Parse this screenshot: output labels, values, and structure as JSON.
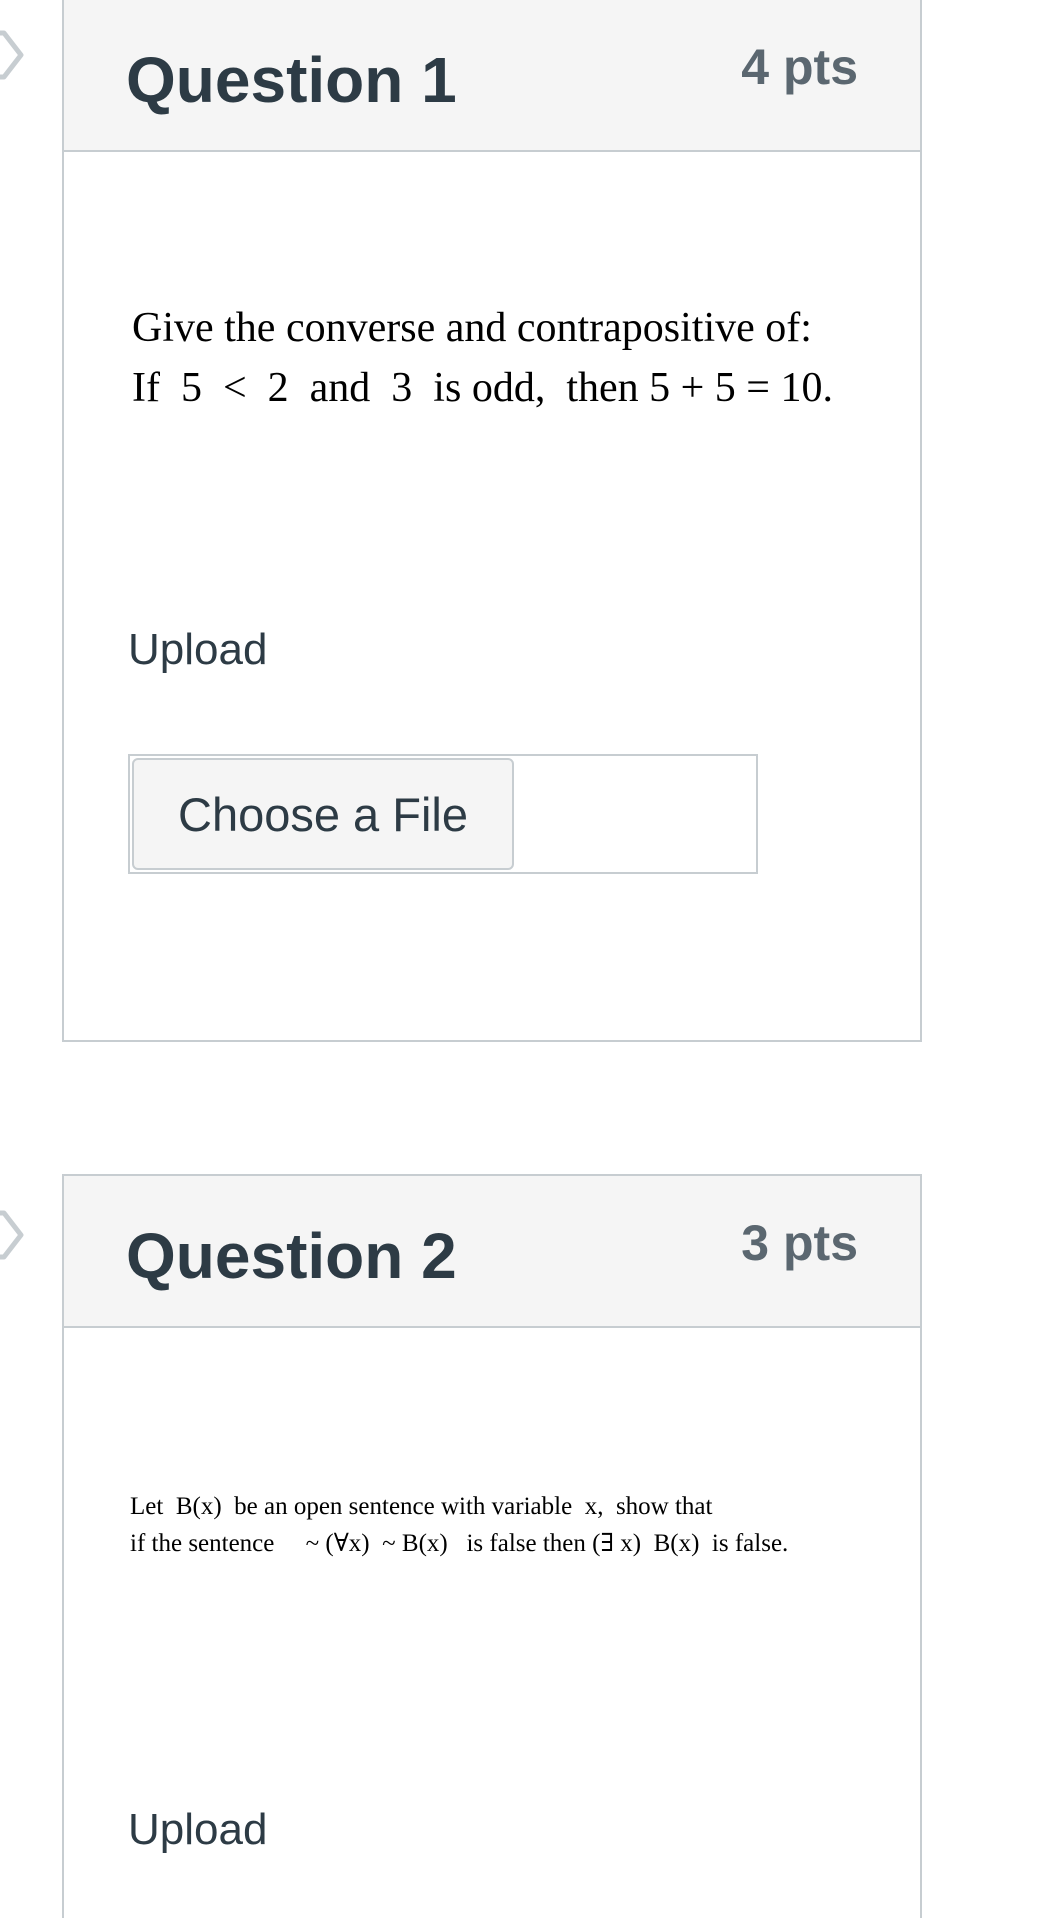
{
  "questions": [
    {
      "title": "Question 1",
      "points": "4 pts",
      "prompt_lines": [
        "Give the converse and contrapositive of:",
        "If  5  <  2  and  3  is odd,  then 5 + 5 = 10."
      ],
      "upload_label": "Upload",
      "file_button_label": "Choose a File"
    },
    {
      "title": "Question 2",
      "points": "3 pts",
      "prompt_lines": [
        "Let  B(x)  be an open sentence with variable  x,  show that",
        "if the sentence     ~ (∀x)  ~ B(x)   is false then (∃ x)  B(x)  is false."
      ],
      "upload_label": "Upload"
    }
  ],
  "colors": {
    "header_bg": "#f5f5f5",
    "border": "#c7cdd1",
    "title_text": "#2d3b45",
    "points_text": "#5b6770"
  },
  "icons": {
    "flag": "bookmark-flag-icon"
  }
}
